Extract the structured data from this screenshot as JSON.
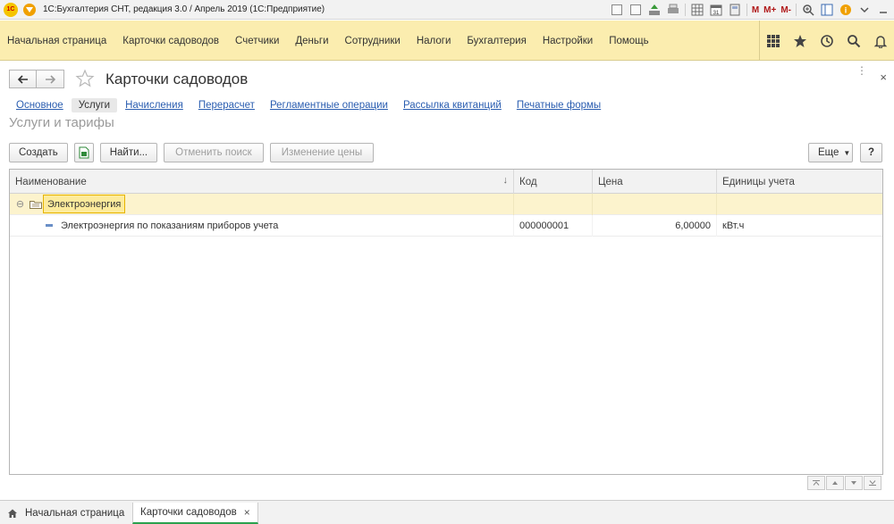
{
  "window": {
    "title": "1С:Бухгалтерия СНТ, редакция 3.0 / Апрель 2019  (1С:Предприятие)",
    "logo_text": "1С",
    "toolbar_icons": [
      "save-icon",
      "print-icon",
      "upload-icon",
      "printer-icon",
      "table-icon",
      "calendar-icon",
      "calculator-icon"
    ],
    "memory_labels": [
      "M",
      "M+",
      "M-"
    ]
  },
  "menu": {
    "items": [
      "Начальная страница",
      "Карточки садоводов",
      "Счетчики",
      "Деньги",
      "Сотрудники",
      "Налоги",
      "Бухгалтерия",
      "Настройки",
      "Помощь"
    ],
    "right_icons": [
      "apps-grid-icon",
      "favorites-star-icon",
      "history-icon",
      "search-icon",
      "bell-icon"
    ]
  },
  "form": {
    "title": "Карточки садоводов",
    "more_label": "⋮",
    "close_label": "×",
    "tabs": [
      "Основное",
      "Услуги",
      "Начисления",
      "Перерасчет",
      "Регламентные операции",
      "Рассылка квитанций",
      "Печатные формы"
    ],
    "active_tab": 1,
    "section_title": "Услуги и тарифы"
  },
  "toolbar": {
    "create_label": "Создать",
    "find_label": "Найти...",
    "cancel_search_label": "Отменить поиск",
    "change_price_label": "Изменение цены",
    "more_label": "Еще",
    "help_label": "?"
  },
  "table": {
    "columns": [
      "Наименование",
      "Код",
      "Цена",
      "Единицы учета"
    ],
    "groups": [
      {
        "name": "Электроэнергия",
        "expand_symbol": "⊖",
        "items": [
          {
            "name": "Электроэнергия по показаниям приборов учета",
            "code": "000000001",
            "price": "6,00000",
            "unit": "кВт.ч"
          }
        ]
      }
    ]
  },
  "bottom_tabs": {
    "home_label": "Начальная страница",
    "active_label": "Карточки садоводов",
    "close_label": "×"
  },
  "colors": {
    "menu_bg": "#fbedaf",
    "group_row_bg": "#fcf3cd",
    "link": "#2a5db0",
    "active_tab_underline": "#2aa14e"
  }
}
